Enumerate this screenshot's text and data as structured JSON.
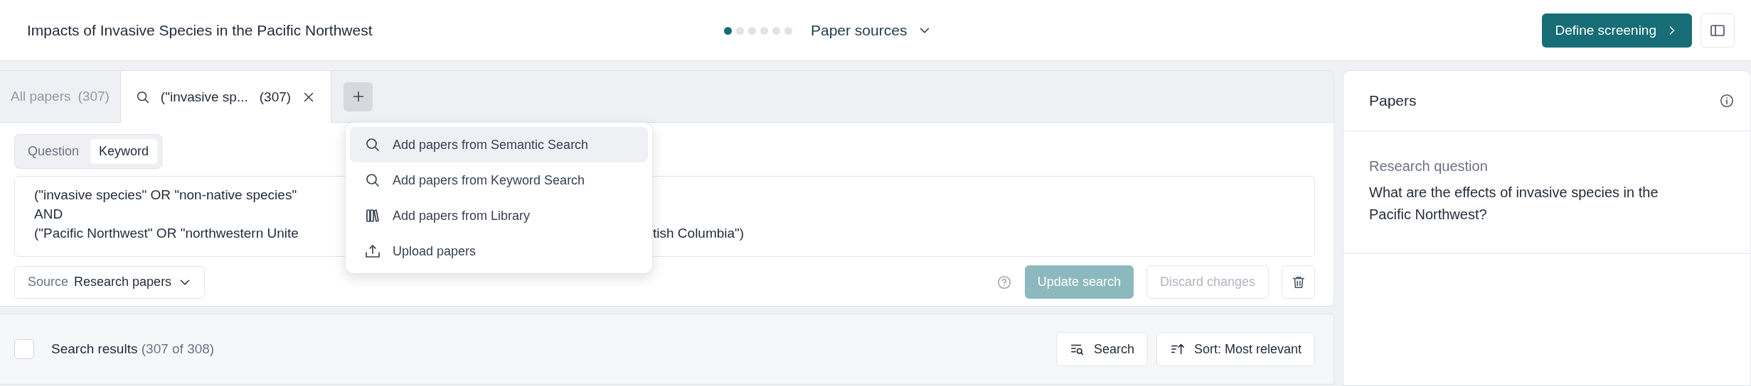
{
  "header": {
    "title": "Impacts of Invasive Species in the Pacific Northwest",
    "steps": [
      {
        "selected": true
      },
      {
        "selected": false
      },
      {
        "selected": false
      },
      {
        "selected": false
      },
      {
        "selected": false
      },
      {
        "selected": false
      }
    ],
    "stage": "Paper sources",
    "primary_button": "Define screening"
  },
  "tabs": [
    {
      "kind": "all",
      "label": "All papers",
      "count": "(307)",
      "selected": false
    },
    {
      "kind": "search",
      "label": "(\"invasive sp...",
      "count": "(307)",
      "selected": true
    }
  ],
  "add_menu": {
    "items": [
      {
        "kind": "search",
        "label": "Add papers from Semantic Search",
        "selected": true
      },
      {
        "kind": "search",
        "label": "Add papers from Keyword Search",
        "selected": false
      },
      {
        "kind": "library",
        "label": "Add papers from Library",
        "selected": false
      },
      {
        "kind": "upload",
        "label": "Upload papers",
        "selected": false
      }
    ]
  },
  "mode_toggle": [
    {
      "label": "Question",
      "selected": false
    },
    {
      "label": "Keyword",
      "selected": true
    }
  ],
  "query": {
    "lines": [
      [
        "(\"invasive species\" OR \"non-native species\""
      ],
      [
        "AND"
      ],
      [
        "(\"Pacific Northwest\" OR \"northwestern Unite",
        "tish Columbia\")"
      ]
    ]
  },
  "source": {
    "label": "Source",
    "value": "Research papers"
  },
  "actions": {
    "update": {
      "label": "Update search",
      "disabled": true
    },
    "discard": {
      "label": "Discard changes",
      "disabled": true
    }
  },
  "results": {
    "label": "Search results",
    "count": "(307 of 308)",
    "checked": false,
    "search_button": "Search",
    "sort_button": "Sort: Most relevant"
  },
  "side_panel": {
    "title": "Papers",
    "section_label": "Research question",
    "question": "What are the effects of invasive species in the Pacific Northwest?"
  }
}
